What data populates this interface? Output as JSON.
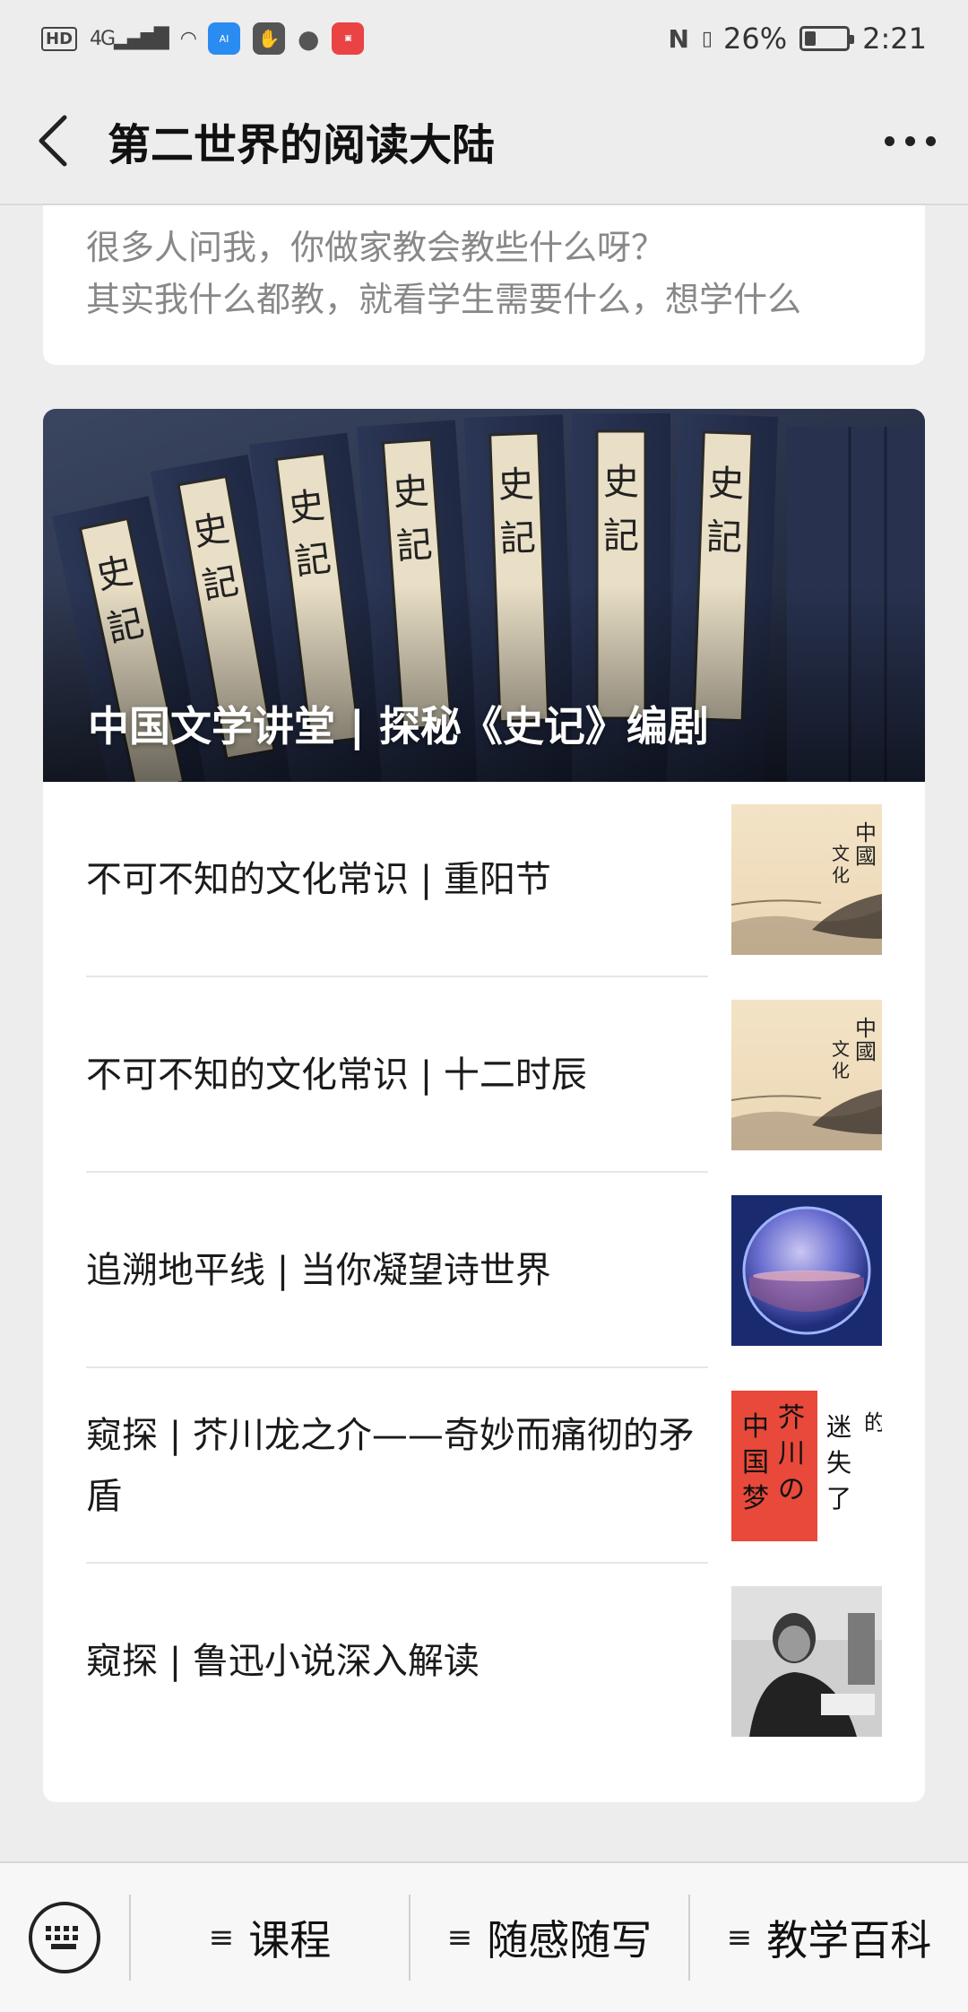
{
  "status_bar": {
    "hd": "HD",
    "network": "4G",
    "nfc": "N",
    "battery": "26%",
    "battery_level": 0.26,
    "time": "2:21"
  },
  "header": {
    "title": "第二世界的阅读大陆"
  },
  "top_card": {
    "line1": "很多人问我，你做家教会教些什么呀？",
    "line2": "其实我什么都教，就看学生需要什么，想学什么"
  },
  "main_card": {
    "cover_title": "中国文学讲堂 | 探秘《史记》编剧",
    "items": [
      {
        "title": "不可不知的文化常识 | 重阳节",
        "thumb": "ink-landscape"
      },
      {
        "title": "不可不知的文化常识 | 十二时辰",
        "thumb": "ink-landscape"
      },
      {
        "title": "追溯地平线 | 当你凝望诗世界",
        "thumb": "glass-globe"
      },
      {
        "title": "窥探 | 芥川龙之介——奇妙而痛彻的矛盾",
        "thumb": "red-calligraphy"
      },
      {
        "title": "窥探 | 鲁迅小说深入解读",
        "thumb": "portrait-photo"
      }
    ]
  },
  "bottom_menu": {
    "items": [
      {
        "label": "课程"
      },
      {
        "label": "随感随写"
      },
      {
        "label": "教学百科"
      }
    ]
  },
  "colors": {
    "page_bg": "#ededed",
    "card_bg": "#ffffff",
    "muted_text": "#888888",
    "divider": "#e6e6e6"
  }
}
